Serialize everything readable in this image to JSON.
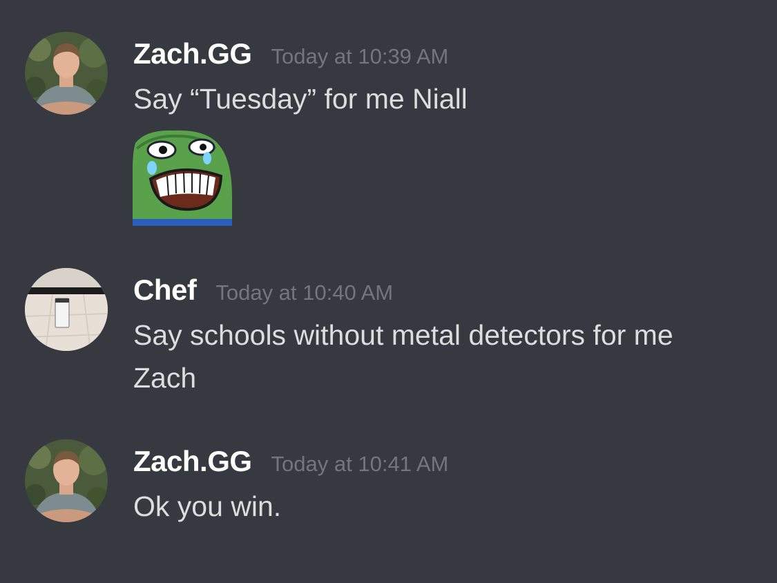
{
  "messages": [
    {
      "username": "Zach.GG",
      "timestamp": "Today at 10:39 AM",
      "lines": [
        "Say “Tuesday” for me Niall"
      ],
      "avatar_icon": "person-avatar-icon",
      "attachment_icon": "laughing-frog-emote-icon"
    },
    {
      "username": "Chef",
      "timestamp": "Today at 10:40 AM",
      "lines": [
        "Say schools without metal detectors for me",
        "Zach"
      ],
      "avatar_icon": "room-photo-avatar-icon"
    },
    {
      "username": "Zach.GG",
      "timestamp": "Today at 10:41 AM",
      "lines": [
        "Ok you win."
      ],
      "avatar_icon": "person-avatar-icon"
    }
  ],
  "colors": {
    "background": "#36393f",
    "username": "#ffffff",
    "timestamp": "#72767d",
    "message_text": "#dcddde"
  }
}
